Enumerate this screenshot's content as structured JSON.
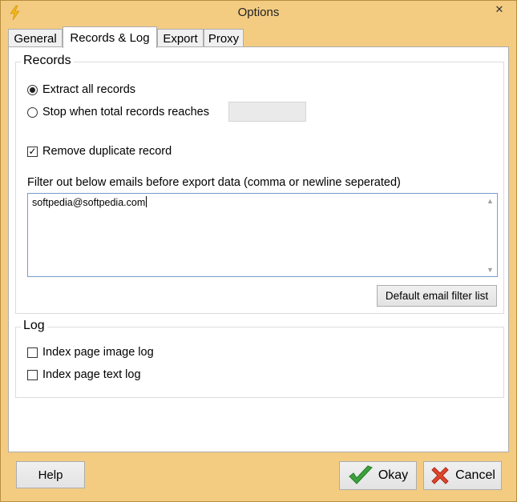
{
  "window": {
    "title": "Options",
    "close_label": "✕"
  },
  "tabs": [
    {
      "label": "General"
    },
    {
      "label": "Records & Log"
    },
    {
      "label": "Export"
    },
    {
      "label": "Proxy"
    }
  ],
  "active_tab": "Records & Log",
  "records": {
    "group_title": "Records",
    "extract_all_label": "Extract all records",
    "extract_all_checked": true,
    "stop_when_label": "Stop when total records reaches",
    "stop_when_checked": false,
    "stop_value": "",
    "remove_duplicate_label": "Remove duplicate record",
    "remove_duplicate_checked": true,
    "filter_label": "Filter out below emails before export data (comma or newline seperated)",
    "filter_value": "softpedia@softpedia.com",
    "default_filter_button": "Default email filter list"
  },
  "log": {
    "group_title": "Log",
    "image_log_label": "Index page image log",
    "image_log_checked": false,
    "text_log_label": "Index page text log",
    "text_log_checked": false
  },
  "buttons": {
    "help": "Help",
    "okay": "Okay",
    "cancel": "Cancel"
  },
  "icons": {
    "app": "lightning-icon",
    "okay": "checkmark-icon",
    "cancel": "x-icon"
  },
  "colors": {
    "frame": "#f3cc82",
    "okay_icon": "#3aa23a",
    "cancel_icon": "#e0452d"
  }
}
